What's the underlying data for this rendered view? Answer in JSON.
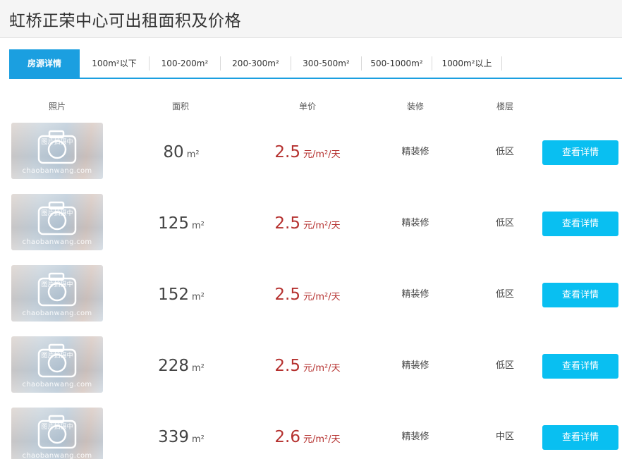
{
  "page": {
    "title": "虹桥正荣中心可出租面积及价格"
  },
  "tabs": [
    {
      "label": "房源详情",
      "active": true
    },
    {
      "label": "100m²以下"
    },
    {
      "label": "100-200m²"
    },
    {
      "label": "200-300m²"
    },
    {
      "label": "300-500m²"
    },
    {
      "label": "500-1000m²"
    },
    {
      "label": "1000m²以上"
    }
  ],
  "columns": {
    "photo": "照片",
    "area": "面积",
    "price": "单价",
    "decoration": "装修",
    "floor": "楼层"
  },
  "placeholder": {
    "text": "图片拍摄中",
    "watermark": "chaobanwang.com"
  },
  "units": {
    "area": "m²",
    "price": "元/m²/天"
  },
  "rows": [
    {
      "area": "80",
      "price": "2.5",
      "decoration": "精装修",
      "floor": "低区",
      "button": "查看详情"
    },
    {
      "area": "125",
      "price": "2.5",
      "decoration": "精装修",
      "floor": "低区",
      "button": "查看详情"
    },
    {
      "area": "152",
      "price": "2.5",
      "decoration": "精装修",
      "floor": "低区",
      "button": "查看详情"
    },
    {
      "area": "228",
      "price": "2.5",
      "decoration": "精装修",
      "floor": "低区",
      "button": "查看详情"
    },
    {
      "area": "339",
      "price": "2.6",
      "decoration": "精装修",
      "floor": "中区",
      "button": "查看详情"
    }
  ],
  "colors": {
    "accent": "#1b9fe0",
    "button": "#09bff1",
    "price": "#b5312f"
  }
}
